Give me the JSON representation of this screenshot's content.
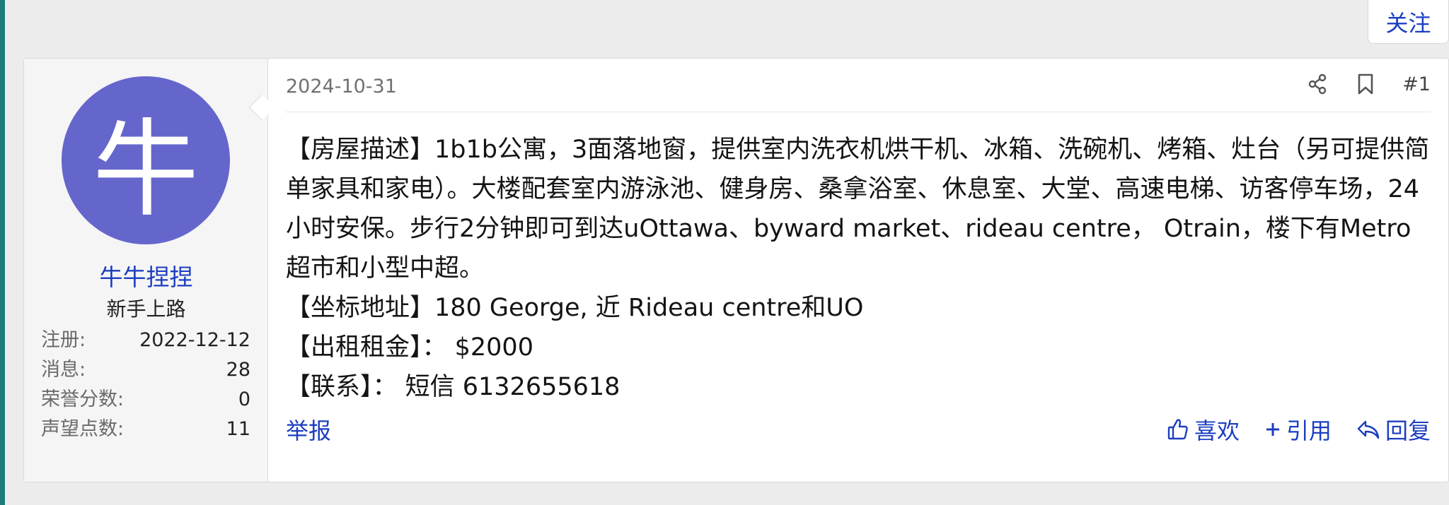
{
  "follow": {
    "label": "关注"
  },
  "user": {
    "avatar_letter": "牛",
    "avatar_color": "#6566cc",
    "name": "牛牛捏捏",
    "title": "新手上路",
    "stats": [
      {
        "label": "注册:",
        "value": "2022-12-12"
      },
      {
        "label": "消息:",
        "value": "28"
      },
      {
        "label": "荣誉分数:",
        "value": "0"
      },
      {
        "label": "声望点数:",
        "value": "11"
      }
    ]
  },
  "post": {
    "date": "2024-10-31",
    "number": "#1",
    "icons": {
      "share": "share-icon",
      "bookmark": "bookmark-icon"
    },
    "body": [
      "【房屋描述】1b1b公寓，3面落地窗，提供室内洗衣机烘干机、冰箱、洗碗机、烤箱、灶台（另可提供简单家具和家电）。大楼配套室内游泳池、健身房、桑拿浴室、休息室、大堂、高速电梯、访客停车场，24小时安保。步行2分钟即可到达uOttawa、byward market、rideau centre， Otrain，楼下有Metro超市和小型中超。",
      "【坐标地址】180 George, 近 Rideau centre和UO",
      "【出租租金】： $2000",
      "【联系】： 短信 6132655618"
    ],
    "footer": {
      "report": "举报",
      "like": "喜欢",
      "quote": "引用",
      "reply": "回复"
    }
  },
  "colors": {
    "link": "#1c3ec0",
    "page_bg": "#ececec"
  }
}
